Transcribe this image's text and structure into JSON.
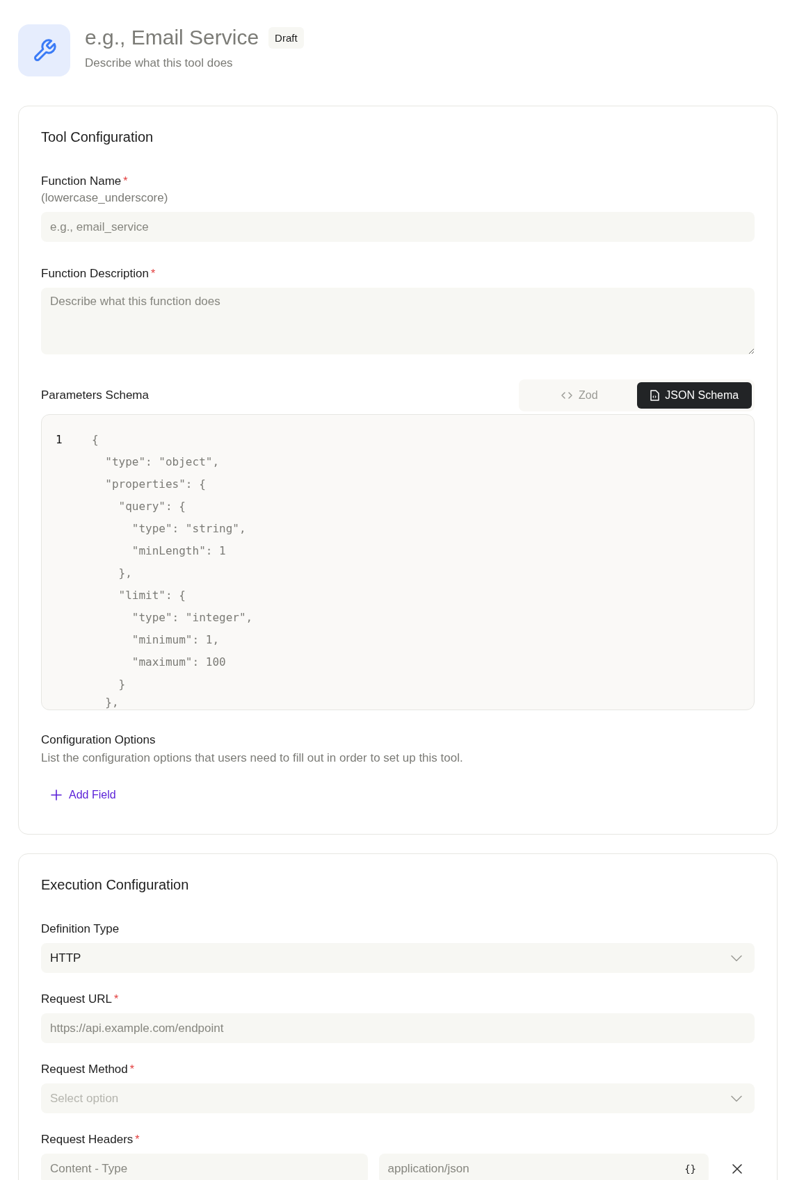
{
  "header": {
    "title": "e.g., Email Service",
    "badge": "Draft",
    "subtitle": "Describe what this tool does"
  },
  "tool_configuration": {
    "title": "Tool Configuration",
    "function_name": {
      "label": "Function Name",
      "required_mark": "*",
      "hint": "(lowercase_underscore)",
      "placeholder": "e.g., email_service"
    },
    "function_description": {
      "label": "Function Description",
      "required_mark": "*",
      "placeholder": "Describe what this function does"
    },
    "parameters_schema": {
      "label": "Parameters Schema",
      "tabs": [
        {
          "label": "Zod",
          "kind": "code",
          "selected": false
        },
        {
          "label": "JSON Schema",
          "kind": "file",
          "selected": true
        }
      ],
      "line_number": "1",
      "code_lines": [
        "{",
        "  \"type\": \"object\",",
        "  \"properties\": {",
        "    \"query\": {",
        "      \"type\": \"string\",",
        "      \"minLength\": 1",
        "    },",
        "    \"limit\": {",
        "      \"type\": \"integer\",",
        "      \"minimum\": 1,",
        "      \"maximum\": 100",
        "    }",
        "  },"
      ]
    },
    "configuration_options": {
      "label": "Configuration Options",
      "description": "List the configuration options that users need to fill out in order to set up this tool.",
      "add_button": "Add Field"
    }
  },
  "execution_configuration": {
    "title": "Execution Configuration",
    "fields": [
      {
        "kind": "select",
        "label": "Definition Type",
        "value": "HTTP"
      },
      {
        "kind": "input",
        "label": "Request URL",
        "required_mark": "*",
        "placeholder": "https://api.example.com/endpoint"
      },
      {
        "kind": "select",
        "label": "Request Method",
        "required_mark": "*",
        "placeholder": "Select option"
      },
      {
        "kind": "headers",
        "label": "Request Headers",
        "required_mark": "*",
        "key_placeholder": "Content - Type",
        "value_placeholder": "application/json",
        "value_icon": "{}"
      }
    ]
  }
}
